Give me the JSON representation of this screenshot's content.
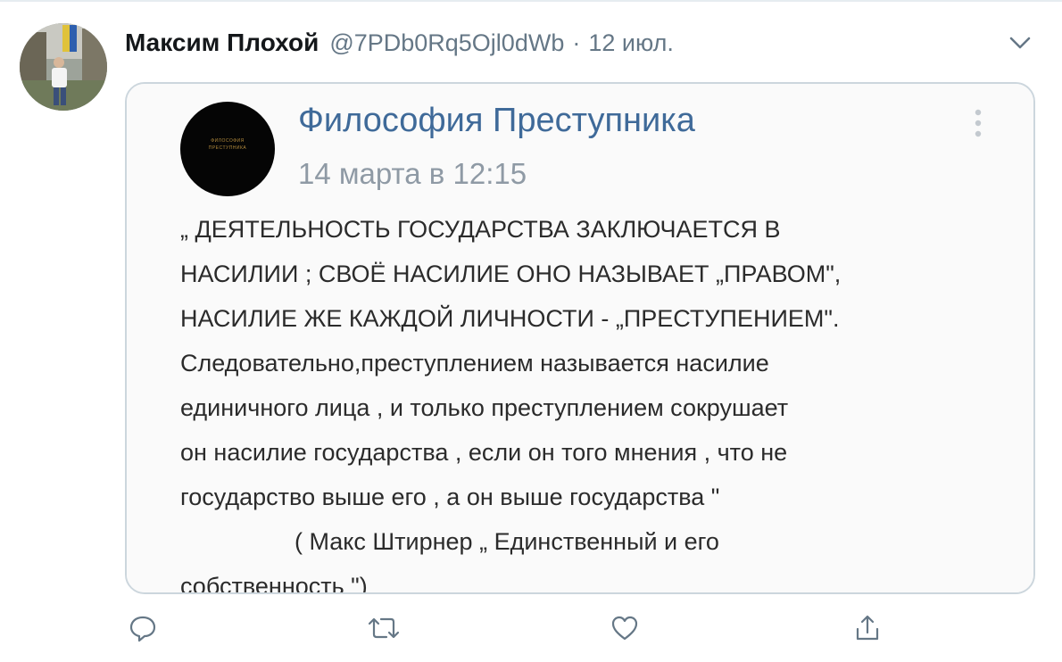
{
  "tweet": {
    "author_name": "Максим Плохой",
    "author_handle": "@7PDb0Rq5Ojl0dWb",
    "separator": "·",
    "timestamp": "12 июл.",
    "avatar_icon": "user-photo-avatar",
    "menu_icon": "chevron-down-icon"
  },
  "embedded_post": {
    "group_name": "Философия Преступника",
    "post_date": "14 марта в 12:15",
    "group_avatar_text": "ФИЛОСОФИЯ ПРЕСТУПНИКА",
    "more_icon": "more-vertical-icon",
    "lines": [
      "„ ДЕЯТЕЛЬНОСТЬ ГОСУДАРСТВА ЗАКЛЮЧАЕТСЯ В",
      "НАСИЛИИ ; СВОЁ НАСИЛИЕ ОНО НАЗЫВАЕТ „ПРАВОМ\",",
      "НАСИЛИЕ ЖЕ КАЖДОЙ ЛИЧНОСТИ - „ПРЕСТУПЕНИЕМ\".",
      "Следовательно,преступлением называется насилие",
      "единичного лица , и только преступлением сокрушает",
      "он насилие государства , если он того мнения , что не",
      "государство выше его , а он выше государства \"",
      "( Макс Штирнер „ Единственный и его",
      "собственность \")"
    ]
  },
  "actions": {
    "reply_icon": "reply-icon",
    "retweet_icon": "retweet-icon",
    "like_icon": "heart-icon",
    "share_icon": "share-icon"
  },
  "colors": {
    "name": "#14171a",
    "secondary": "#657786",
    "vk_link": "#3f6a99",
    "border": "#ccd6dd"
  }
}
